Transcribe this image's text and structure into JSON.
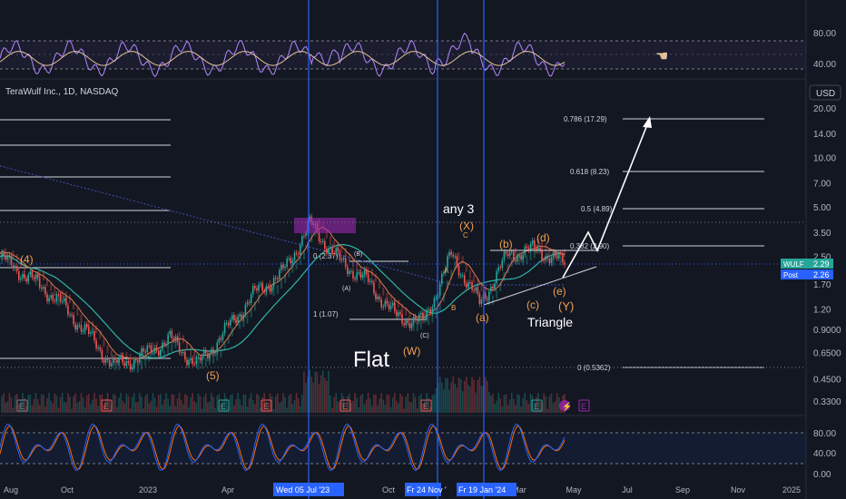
{
  "header": {
    "symbol_line": "TeraWulf Inc., 1D, NASDAQ",
    "currency": "USD"
  },
  "colors": {
    "bg": "#131722",
    "up": "#26a69a",
    "down": "#ef5350",
    "vline": "#2962ff",
    "fib": "#d1d4dc",
    "wave": "#f0a050",
    "rsi": "#b388ff",
    "k": "#2962ff",
    "d": "#ff6d00",
    "ribbon_red": "#ef5350",
    "ribbon_green": "#26a69a",
    "ma_blue": "#3f51b5",
    "ma_teal": "#2fb4a4",
    "ma_orange": "#e07a4a"
  },
  "rsi_panel": {
    "levels": [
      "80.00",
      "40.00"
    ]
  },
  "stoch_panel": {
    "levels": [
      "80.00",
      "40.00",
      "0.00"
    ]
  },
  "price_axis": {
    "labels": [
      "20.00",
      "14.00",
      "10.00",
      "7.00",
      "5.00",
      "3.50",
      "2.50",
      "1.70",
      "1.20",
      "0.9000",
      "0.6500",
      "0.4500",
      "0.3300"
    ]
  },
  "price_tags": [
    {
      "name": "WULF",
      "value": "2.29",
      "color": "#26a69a"
    },
    {
      "name": "Post",
      "value": "2.26",
      "color": "#2962ff"
    }
  ],
  "time_axis": {
    "labels": [
      "Aug",
      "Oct",
      "2023",
      "Apr",
      "Oct",
      "Mar",
      "May",
      "Jul",
      "Sep",
      "Nov",
      "2025"
    ]
  },
  "time_highlights": [
    "Wed 05 Jul '23",
    "Fr 24 Nov '",
    "Fr 19 Jan '24"
  ],
  "fib_levels": [
    {
      "label": "0.786 (17.29)"
    },
    {
      "label": "0.618 (8.23)"
    },
    {
      "label": "0.5 (4.89)"
    },
    {
      "label": "0.382 (2.90)"
    },
    {
      "label": "0 (0.5362)"
    }
  ],
  "fib_levels_mid": [
    {
      "label": "0 (2.37)"
    },
    {
      "label": "1 (1.07)"
    }
  ],
  "annotations": {
    "wave4": "(4)",
    "wave5": "(5)",
    "A_paren": "(A)",
    "B_paren": "(B)",
    "C_paren": "(C)",
    "W": "(W)",
    "flat": "Flat",
    "any3": "any 3",
    "X": "(X)",
    "a": "A",
    "b": "B",
    "c": "C",
    "ta": "(a)",
    "tb": "(b)",
    "tc": "(c)",
    "td": "(d)",
    "te": "(e)",
    "Y": "(Y)",
    "triangle": "Triangle"
  },
  "event_markers": [
    "E",
    "E",
    "E",
    "E",
    "E",
    "E",
    "E",
    "E",
    "E"
  ],
  "chart_data": {
    "type": "line",
    "title": "TeraWulf Inc., 1D, NASDAQ",
    "y_scale": "log",
    "ylim": [
      0.33,
      20.0
    ],
    "y_ticks": [
      20.0,
      14.0,
      10.0,
      7.0,
      5.0,
      3.5,
      2.5,
      1.7,
      1.2,
      0.9,
      0.65,
      0.45,
      0.33
    ],
    "x_ticks": [
      "Aug",
      "Oct",
      "2023",
      "Apr",
      "Oct",
      "Mar",
      "May",
      "Jul",
      "Sep",
      "Nov",
      "2025"
    ],
    "series": [
      {
        "name": "WULF",
        "x": [
          "2022-08",
          "2022-09",
          "2022-10",
          "2022-11",
          "2022-12",
          "2023-01",
          "2023-02",
          "2023-03",
          "2023-04",
          "2023-05",
          "2023-06",
          "2023-07",
          "2023-08",
          "2023-09",
          "2023-10",
          "2023-11",
          "2023-12",
          "2024-01",
          "2024-02",
          "2024-03",
          "2024-04"
        ],
        "values": [
          2.5,
          1.9,
          1.4,
          0.9,
          0.55,
          0.62,
          0.8,
          0.55,
          0.9,
          1.5,
          2.0,
          4.0,
          2.4,
          1.8,
          1.1,
          1.0,
          2.6,
          1.3,
          2.6,
          2.8,
          2.29
        ]
      }
    ],
    "last_price": 2.29,
    "post_price": 2.26,
    "projection_target": 17.29
  }
}
